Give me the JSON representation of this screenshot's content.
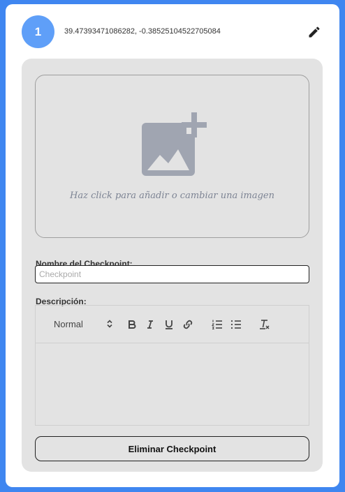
{
  "checkpoint": {
    "number": "1",
    "coordinates": "39.47393471086282, -0.38525104522705084"
  },
  "upload": {
    "hint": "Haz click para añadir o cambiar una imagen",
    "icon": "add-photo-icon"
  },
  "name_field": {
    "label": "Nombre del Checkpoint:",
    "placeholder": "Checkpoint",
    "value": ""
  },
  "description": {
    "label": "Descripción:",
    "toolbar": {
      "format_selected": "Normal",
      "buttons": [
        "bold-icon",
        "italic-icon",
        "underline-icon",
        "link-icon",
        "ordered-list-icon",
        "bullet-list-icon",
        "clear-format-icon"
      ]
    },
    "content": ""
  },
  "actions": {
    "delete_label": "Eliminar Checkpoint"
  },
  "colors": {
    "frame": "#3f86f0",
    "badge": "#5f9ff8",
    "panel": "#e3e3e3",
    "icon_gray": "#a0a5b1"
  }
}
